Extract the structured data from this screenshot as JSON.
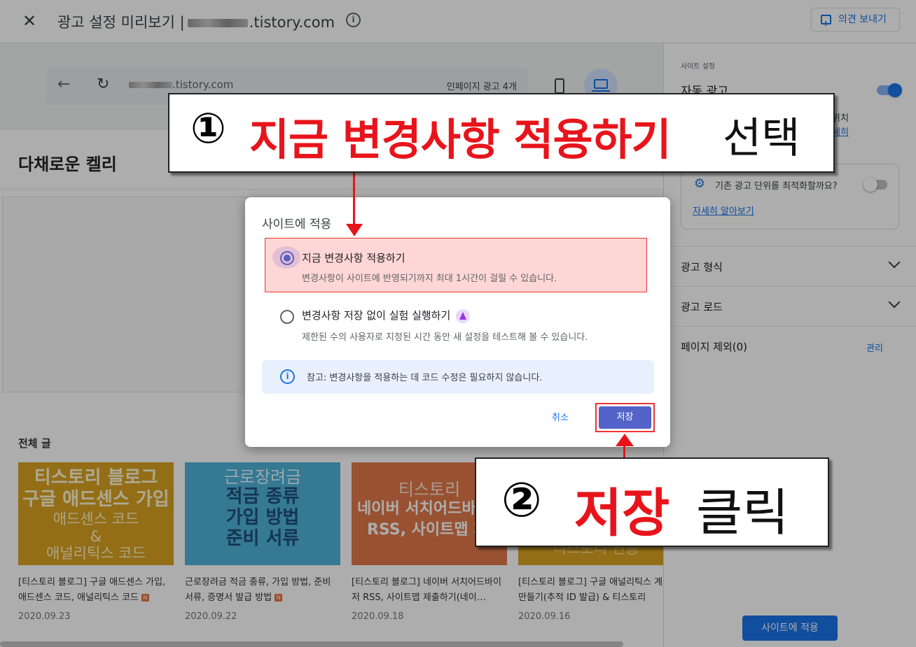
{
  "topbar": {
    "title": "광고 설정 미리보기 |",
    "domain_suffix": ".tistory.com",
    "feedback_label": "의견 보내기"
  },
  "browser_bar": {
    "url_suffix": ".tistory.com",
    "inpage_ads": "인페이지 광고 4개"
  },
  "site": {
    "blog_title": "다채로운 켈리",
    "section_label": "전체 글",
    "posts": [
      {
        "thumb_lines": [
          "티스토리 블로그",
          "구글 애드센스 가입",
          "애드센스 코드",
          "&",
          "애널리틱스 코드"
        ],
        "thumb_bg": "#d9a323",
        "caption": "[티스토리 블로그] 구글 애드센스 가입, 애드센스 코드, 애널리틱스 코드",
        "badge": "N",
        "date": "2020.09.23"
      },
      {
        "thumb_lines": [
          "근로장려금",
          "적금 종류",
          "가입 방법",
          "준비 서류"
        ],
        "thumb_bg": "#4fb3d9",
        "caption": "근로장려금 적금 종류, 가입 방법, 준비 서류, 증명서 발급 방법",
        "badge": "N",
        "date": "2020.09.22"
      },
      {
        "thumb_lines": [
          "티스토리",
          "네이버 서치어드바",
          "RSS, 사이트맵 제"
        ],
        "thumb_bg": "#e07a4a",
        "caption": "[티스토리 블로그] 네이버 서치어드바이저 RSS, 사이트맵 제출하기(네이…",
        "badge": "",
        "date": "2020.09.18"
      },
      {
        "thumb_lines": [
          "",
          "",
          "티스토리 연동"
        ],
        "thumb_bg": "#d9a323",
        "caption": "[티스토리 블로그] 구글 애널리틱스 계정 만들기(추적 ID 발급) & 티스토리",
        "badge": "",
        "date": "2020.09.16"
      }
    ]
  },
  "right_panel": {
    "section_small": "사이트 설정",
    "auto_ads": "자동 광고",
    "wi_text": "위치",
    "sehi_link": "세히",
    "optimize_text": "기존 광고 단위를 최적화할까요?",
    "learn_more": "자세히 알아보기",
    "rows": [
      {
        "label": "광고 형식"
      },
      {
        "label": "광고 로드"
      },
      {
        "label": "페이지 제외(0)",
        "action": "관리"
      }
    ],
    "apply_button": "사이트에 적용"
  },
  "dialog": {
    "title": "사이트에 적용",
    "option1_label": "지금 변경사항 적용하기",
    "option1_desc": "변경사항이 사이트에 반영되기까지 최대 1시간이 걸릴 수 있습니다.",
    "option2_label": "변경사항 저장 없이 실험 실행하기",
    "option2_desc": "제한된 수의 사용자로 지정된 시간 동안 새 설정을 테스트해 볼 수 있습니다.",
    "note": "참고: 변경사항을 적용하는 데 코드 수정은 필요하지 않습니다.",
    "cancel": "취소",
    "save": "저장"
  },
  "callouts": {
    "c1_num": "①",
    "c1_red": "지금 변경사항 적용하기",
    "c1_black": "선택",
    "c2_num": "②",
    "c2_red": "저장",
    "c2_black": "클릭"
  },
  "colors": {
    "accent": "#1a73e8",
    "annotation_red": "#e8141b",
    "save_button": "#5463c7"
  }
}
